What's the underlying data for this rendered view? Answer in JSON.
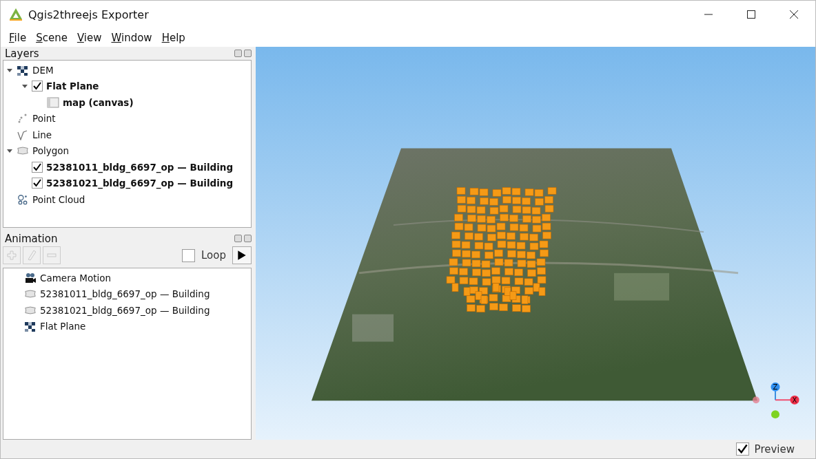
{
  "window": {
    "title": "Qgis2threejs Exporter"
  },
  "menu": [
    {
      "label": "File"
    },
    {
      "label": "Scene"
    },
    {
      "label": "View"
    },
    {
      "label": "Window"
    },
    {
      "label": "Help"
    }
  ],
  "layers_panel": {
    "title": "Layers",
    "items": [
      {
        "label": "DEM",
        "kind": "dem",
        "bold": false,
        "expanded": true,
        "children": [
          {
            "label": "Flat Plane",
            "checked": true,
            "bold": true,
            "expanded": true,
            "children": [
              {
                "label": "map (canvas)",
                "kind": "map",
                "bold": true
              }
            ]
          }
        ]
      },
      {
        "label": "Point",
        "kind": "point",
        "bold": false
      },
      {
        "label": "Line",
        "kind": "line",
        "bold": false
      },
      {
        "label": "Polygon",
        "kind": "polygon",
        "bold": false,
        "expanded": true,
        "children": [
          {
            "label": "52381011_bldg_6697_op — Building",
            "checked": true,
            "bold": true
          },
          {
            "label": "52381021_bldg_6697_op — Building",
            "checked": true,
            "bold": true
          }
        ]
      },
      {
        "label": "Point Cloud",
        "kind": "pointcloud",
        "bold": false
      }
    ]
  },
  "animation_panel": {
    "title": "Animation",
    "tools": [
      {
        "kind": "add",
        "disabled": true
      },
      {
        "kind": "edit",
        "disabled": true
      },
      {
        "kind": "remove",
        "disabled": true
      }
    ],
    "loop": {
      "label": "Loop",
      "checked": false
    },
    "items": [
      {
        "label": "Camera Motion",
        "kind": "camera"
      },
      {
        "label": "52381011_bldg_6697_op — Building",
        "kind": "polygon"
      },
      {
        "label": "52381021_bldg_6697_op — Building",
        "kind": "polygon"
      },
      {
        "label": "Flat Plane",
        "kind": "dem"
      }
    ]
  },
  "view": {
    "axis_labels": [
      "Z",
      "X"
    ]
  },
  "status_bar": {
    "preview": {
      "label": "Preview",
      "checked": true
    }
  }
}
